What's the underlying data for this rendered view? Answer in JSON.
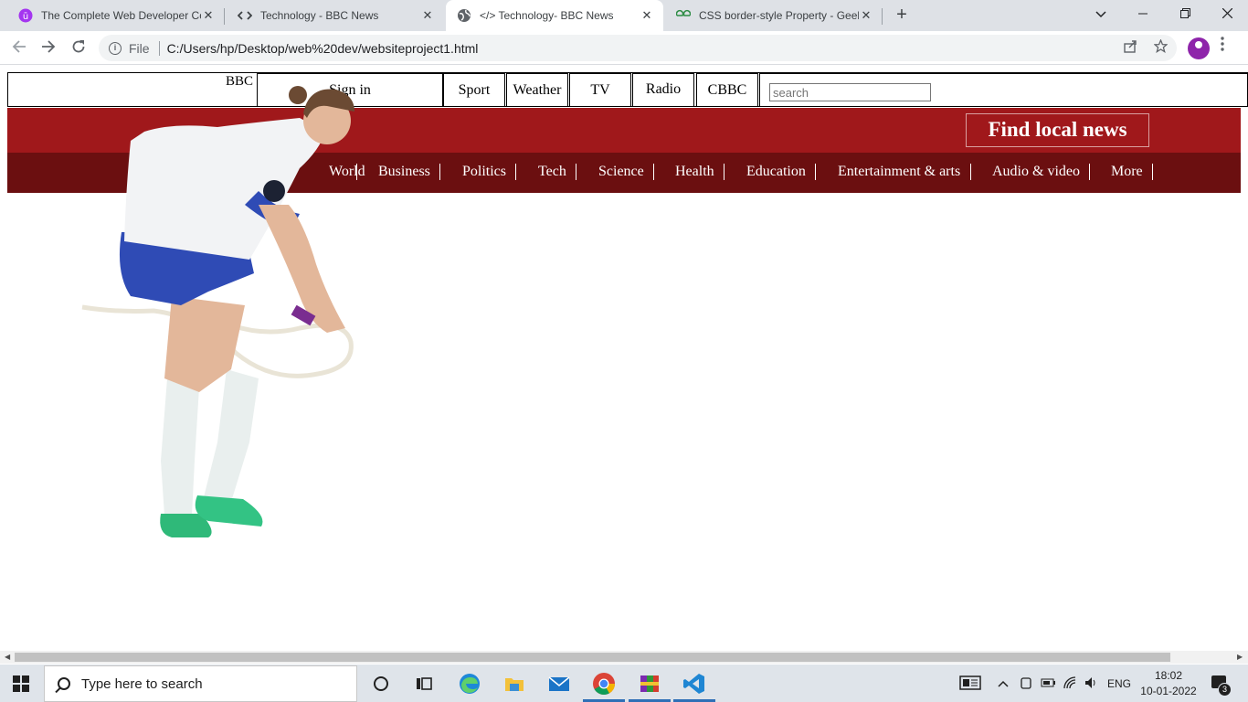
{
  "browser": {
    "tabs": [
      {
        "title": "The Complete Web Developer Co",
        "favicon": "udemy-icon"
      },
      {
        "title": "Technology - BBC News",
        "favicon": "code-icon"
      },
      {
        "title": "</> Technology- BBC News",
        "favicon": "globe-icon",
        "active": true
      },
      {
        "title": "CSS border-style Property - Geek",
        "favicon": "geeksforgeeks-icon"
      }
    ],
    "close_glyph": "✕",
    "new_tab_glyph": "+",
    "address": {
      "scheme_label": "File",
      "url": "C:/Users/hp/Desktop/web%20dev/websiteproject1.html"
    }
  },
  "page": {
    "logo": "BBC",
    "top_links": [
      {
        "label": "Sign in"
      },
      {
        "label": "Sport"
      },
      {
        "label": "Weather"
      },
      {
        "label": "TV"
      },
      {
        "label": "Radio"
      },
      {
        "label": "CBBC"
      }
    ],
    "search_placeholder": "search",
    "find_local_news": "Find local news",
    "sections": [
      "World",
      "Business",
      "Politics",
      "Tech",
      "Science",
      "Health",
      "Education",
      "Entertainment & arts",
      "Audio & video",
      "More"
    ],
    "colors": {
      "banner": "#a0181b",
      "section_nav": "#6b0f10"
    }
  },
  "taskbar": {
    "search_placeholder": "Type here to search",
    "language": "ENG",
    "time": "18:02",
    "date": "10-01-2022",
    "notification_count": "3"
  }
}
